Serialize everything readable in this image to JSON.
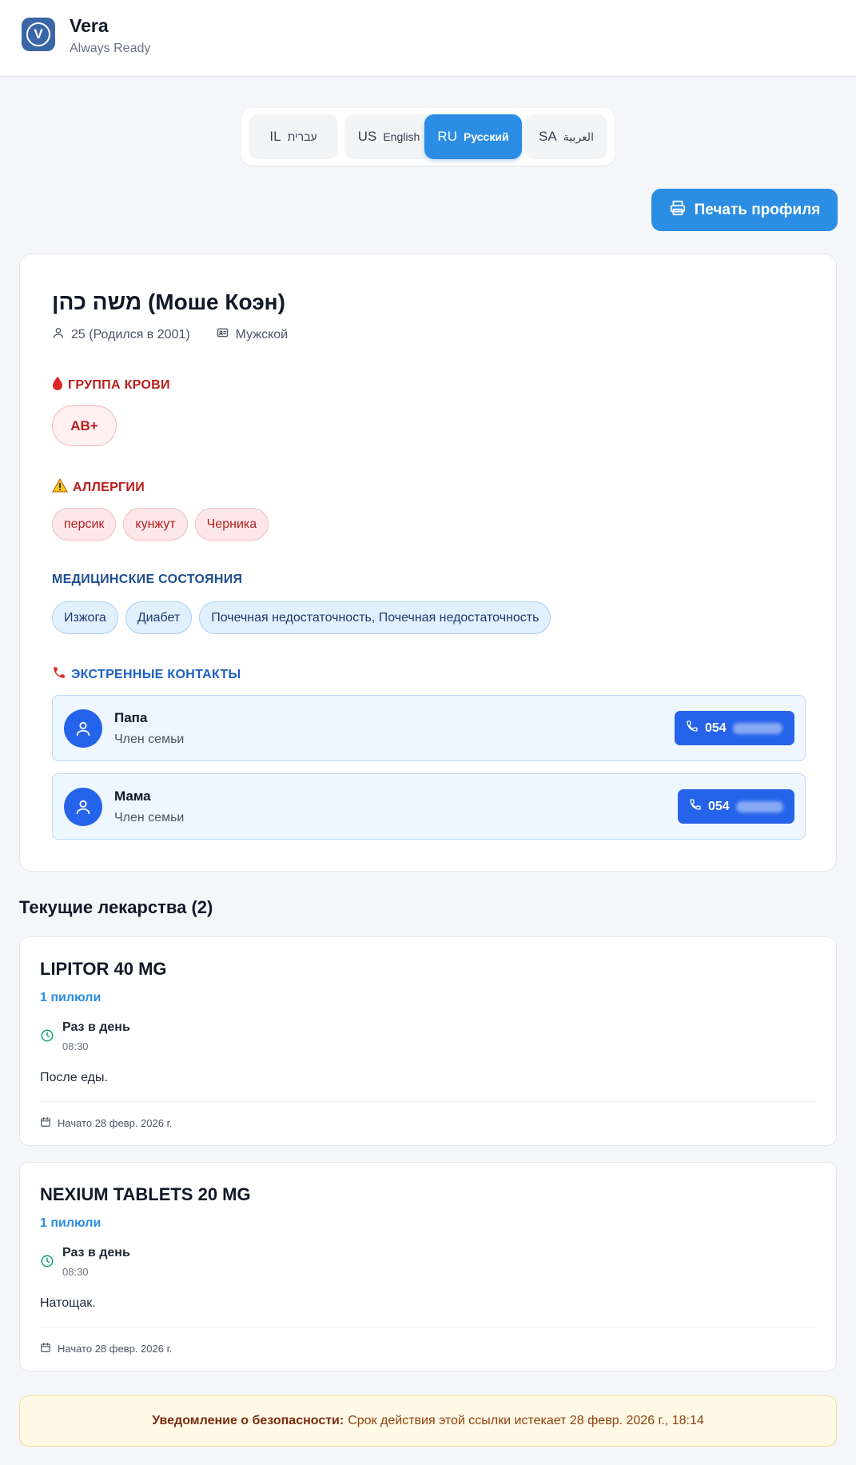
{
  "app": {
    "title": "Vera",
    "subtitle": "Always Ready",
    "logo_letter": "V"
  },
  "languages": [
    {
      "code": "IL",
      "name": "עברית"
    },
    {
      "code": "US",
      "name": "English"
    },
    {
      "code": "RU",
      "name": "Русский",
      "active": true
    },
    {
      "code": "SA",
      "name": "العربية"
    }
  ],
  "toolbar": {
    "print_label": "Печать профиля"
  },
  "profile": {
    "name": "משה כהן (Моше Коэн)",
    "age_label": "25 (Родился в 2001)",
    "gender_label": "Мужской",
    "blood": {
      "title": "ГРУППА КРОВИ",
      "value": "AB+"
    },
    "allergies": {
      "title": "АЛЛЕРГИИ",
      "items": [
        "персик",
        "кунжут",
        "Черника"
      ]
    },
    "conditions": {
      "title": "МЕДИЦИНСКИЕ СОСТОЯНИЯ",
      "items": [
        "Изжога",
        "Диабет",
        "Почечная недостаточность, Почечная недостаточность"
      ]
    },
    "contacts": {
      "title": "ЭКСТРЕННЫЕ КОНТАКТЫ",
      "items": [
        {
          "name": "Папа",
          "role": "Член семьи",
          "phone": "054"
        },
        {
          "name": "Мама",
          "role": "Член семьи",
          "phone": "054"
        }
      ]
    }
  },
  "medications": {
    "title": "Текущие лекарства (2)",
    "items": [
      {
        "name": "LIPITOR 40 MG",
        "dose": "1 пилюли",
        "frequency": "Раз в день",
        "time": "08:30",
        "note": "После еды.",
        "start": "Начато 28 февр. 2026 г."
      },
      {
        "name": "NEXIUM TABLETS 20 MG",
        "dose": "1 пилюли",
        "frequency": "Раз в день",
        "time": "08:30",
        "note": "Натощак.",
        "start": "Начато 28 февр. 2026 г."
      }
    ]
  },
  "notice": {
    "label": "Уведомление о безопасности:",
    "text": "Срок действия этой ссылки истекает 28 февр. 2026 г., 18:14"
  },
  "colors": {
    "accent": "#2b8de3",
    "danger": "#b91c1c",
    "contact_blue": "#2563eb",
    "notice_bg": "#fff9e6"
  }
}
